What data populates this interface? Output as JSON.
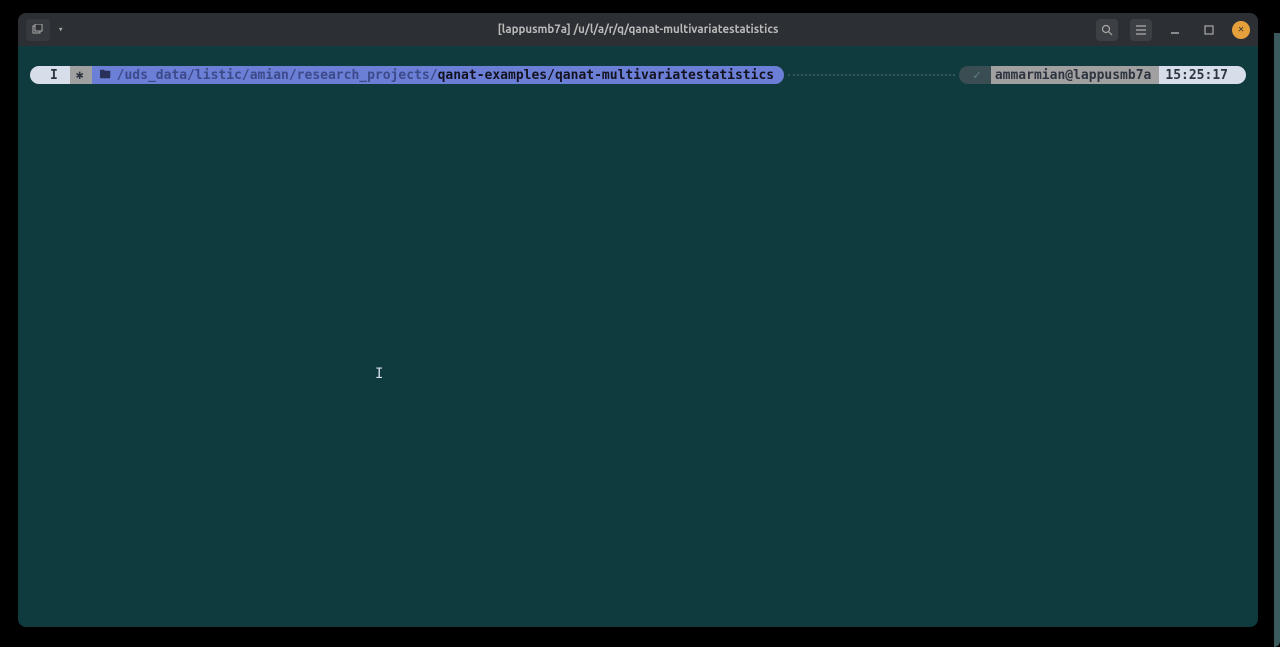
{
  "window": {
    "title": "[lappusmb7a] /u/l/a/r/q/qanat-multivariatestatistics"
  },
  "titlebar": {
    "tab_icon": "⌂⌂"
  },
  "prompt": {
    "mode": "I",
    "gear": "✱",
    "path_prefix": "/uds_data/listic/amian/research_projects/",
    "path_highlight": "qanat-examples/qanat-multivariatestatistics",
    "check": "✓",
    "user_host": "ammarmian@lappusmb7a",
    "time": "15:25:17"
  }
}
